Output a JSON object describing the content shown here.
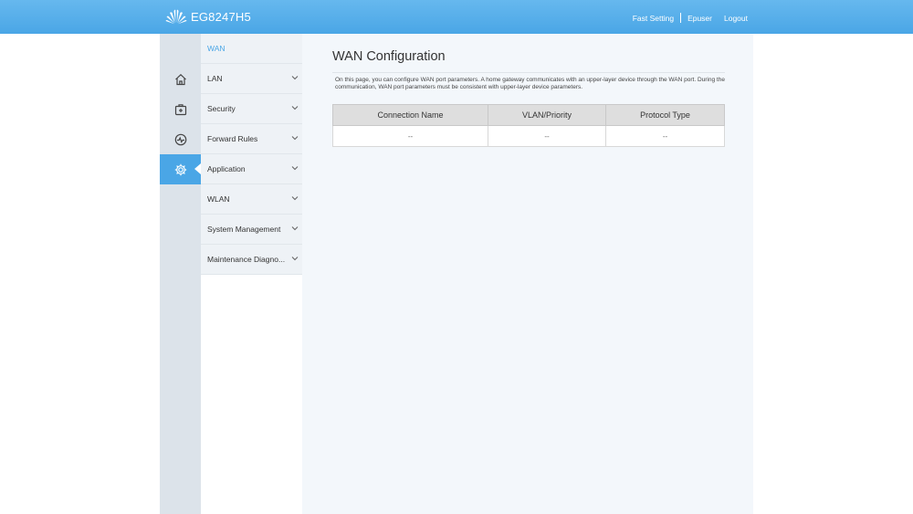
{
  "header": {
    "model": "EG8247H5",
    "links": {
      "fast_setting": "Fast Setting",
      "user": "Epuser",
      "logout": "Logout"
    }
  },
  "iconbar": {
    "items": [
      {
        "name": "home-icon"
      },
      {
        "name": "toolbox-icon"
      },
      {
        "name": "diagnose-icon"
      },
      {
        "name": "gear-icon",
        "active": true
      }
    ]
  },
  "submenu": {
    "header": "WAN",
    "items": [
      {
        "label": "LAN"
      },
      {
        "label": "Security"
      },
      {
        "label": "Forward Rules"
      },
      {
        "label": "Application"
      },
      {
        "label": "WLAN"
      },
      {
        "label": "System Management"
      },
      {
        "label": "Maintenance Diagno..."
      }
    ]
  },
  "main": {
    "title": "WAN Configuration",
    "description": "On this page, you can configure WAN port parameters. A home gateway communicates with an upper-layer device through the WAN port. During the communication, WAN port parameters must be consistent with upper-layer device parameters.",
    "table": {
      "columns": [
        "Connection Name",
        "VLAN/Priority",
        "Protocol Type"
      ],
      "rows": [
        [
          "--",
          "--",
          "--"
        ]
      ]
    }
  },
  "colors": {
    "accent": "#4aa6e6",
    "sidebar": "#dce3ea",
    "submenu": "#eef2f6",
    "content": "#f3f7fb"
  }
}
